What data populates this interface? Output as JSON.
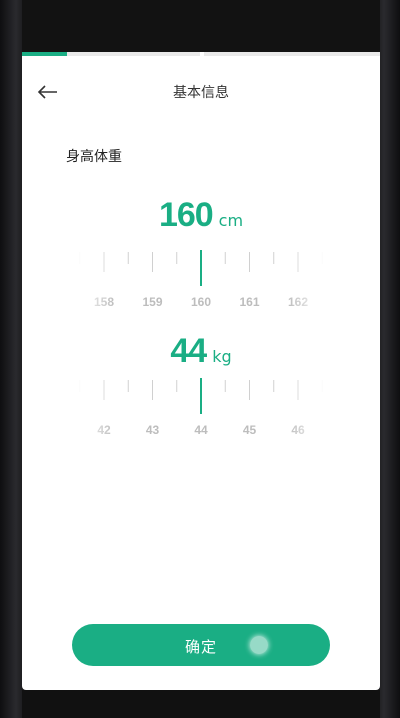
{
  "header": {
    "title": "基本信息",
    "back_icon": "arrow-left-icon"
  },
  "progress": {
    "value": 0.125
  },
  "section": {
    "title": "身高体重"
  },
  "height": {
    "value": "160",
    "unit": "cm",
    "ticks": [
      "158",
      "159",
      "160",
      "161",
      "162"
    ]
  },
  "weight": {
    "value": "44",
    "unit": "kg",
    "ticks": [
      "42",
      "43",
      "44",
      "45",
      "46"
    ]
  },
  "confirm": {
    "label": "确定"
  },
  "colors": {
    "accent": "#1aae84",
    "tick_label": "#bdbdbd",
    "tick_line": "#d0d0d0"
  }
}
